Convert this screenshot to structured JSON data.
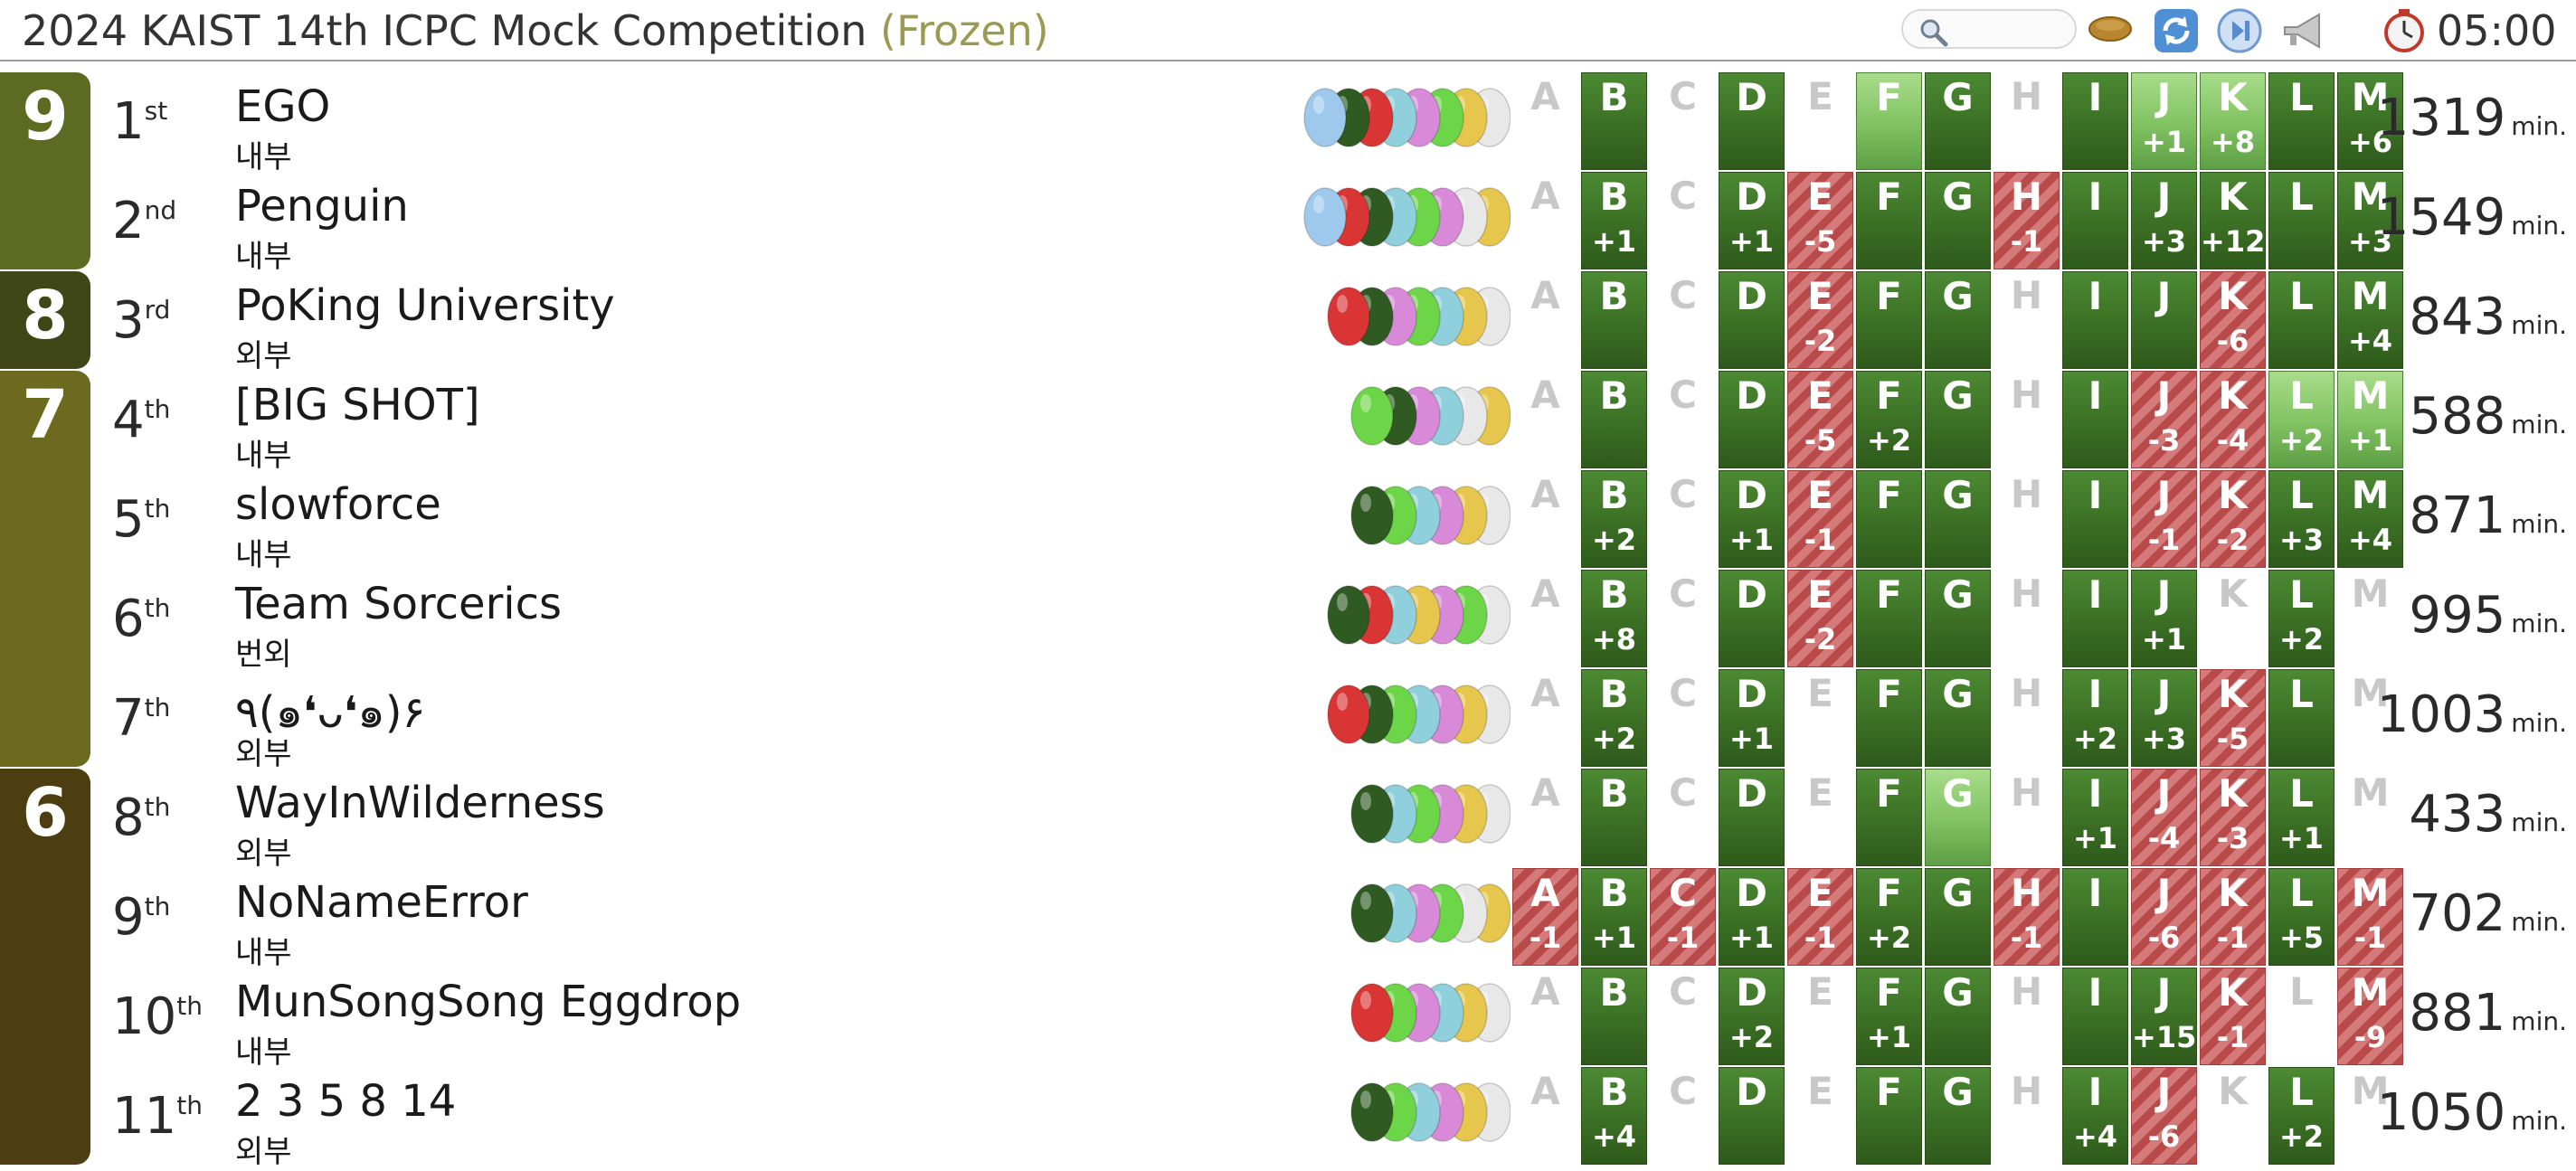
{
  "header": {
    "title": "2024 KAIST 14th ICPC Mock Competition",
    "frozen": "(Frozen)",
    "time": "05:00",
    "icons": [
      "search-icon",
      "football-icon",
      "refresh-icon",
      "skip-icon",
      "megaphone-icon",
      "clock-icon"
    ]
  },
  "problems": [
    "A",
    "B",
    "C",
    "D",
    "E",
    "F",
    "G",
    "H",
    "I",
    "J",
    "K",
    "L",
    "M"
  ],
  "penalty_unit": "min.",
  "groups": [
    {
      "solved": "9",
      "rows": [
        0,
        1
      ],
      "color": "#5c6a22"
    },
    {
      "solved": "8",
      "rows": [
        2,
        2
      ],
      "color": "#3f4716"
    },
    {
      "solved": "7",
      "rows": [
        3,
        6
      ],
      "color": "#6c6a1e"
    },
    {
      "solved": "6",
      "rows": [
        7,
        10
      ],
      "color": "#4d3e11"
    }
  ],
  "teams": [
    {
      "rank": "1",
      "suffix": "st",
      "name": "EGO",
      "affiliation": "내부",
      "balloons": [
        "#9ec9ec",
        "#2f5b22",
        "#d93535",
        "#8fd0dc",
        "#d88ad8",
        "#6dd648",
        "#e6c64c",
        "#e8e8e8"
      ],
      "penalty": "1319",
      "cells": [
        [
          "none",
          ""
        ],
        [
          "solved",
          ""
        ],
        [
          "none",
          ""
        ],
        [
          "solved",
          ""
        ],
        [
          "none",
          ""
        ],
        [
          "first",
          ""
        ],
        [
          "solved",
          ""
        ],
        [
          "none",
          ""
        ],
        [
          "solved",
          ""
        ],
        [
          "first",
          "+1"
        ],
        [
          "first",
          "+8"
        ],
        [
          "solved",
          ""
        ],
        [
          "solved",
          "+6"
        ]
      ]
    },
    {
      "rank": "2",
      "suffix": "nd",
      "name": "Penguin",
      "affiliation": "내부",
      "balloons": [
        "#9ec9ec",
        "#d93535",
        "#2f5b22",
        "#8fd0dc",
        "#6dd648",
        "#d88ad8",
        "#e8e8e8",
        "#e6c64c"
      ],
      "penalty": "1549",
      "cells": [
        [
          "none",
          ""
        ],
        [
          "solved",
          "+1"
        ],
        [
          "none",
          ""
        ],
        [
          "solved",
          "+1"
        ],
        [
          "wrong",
          "-5"
        ],
        [
          "solved",
          ""
        ],
        [
          "solved",
          ""
        ],
        [
          "wrong",
          "-1"
        ],
        [
          "solved",
          ""
        ],
        [
          "solved",
          "+3"
        ],
        [
          "solved",
          "+12"
        ],
        [
          "solved",
          ""
        ],
        [
          "solved",
          "+3"
        ]
      ]
    },
    {
      "rank": "3",
      "suffix": "rd",
      "name": "PoKing University",
      "affiliation": "외부",
      "balloons": [
        "#d93535",
        "#2f5b22",
        "#d88ad8",
        "#6dd648",
        "#8fd0dc",
        "#e6c64c",
        "#e8e8e8"
      ],
      "penalty": "843",
      "cells": [
        [
          "none",
          ""
        ],
        [
          "solved",
          ""
        ],
        [
          "none",
          ""
        ],
        [
          "solved",
          ""
        ],
        [
          "wrong",
          "-2"
        ],
        [
          "solved",
          ""
        ],
        [
          "solved",
          ""
        ],
        [
          "none",
          ""
        ],
        [
          "solved",
          ""
        ],
        [
          "solved",
          ""
        ],
        [
          "wrong",
          "-6"
        ],
        [
          "solved",
          ""
        ],
        [
          "solved",
          "+4"
        ]
      ]
    },
    {
      "rank": "4",
      "suffix": "th",
      "name": "[BIG SHOT]",
      "affiliation": "내부",
      "balloons": [
        "#6dd648",
        "#2f5b22",
        "#d88ad8",
        "#8fd0dc",
        "#e8e8e8",
        "#e6c64c"
      ],
      "penalty": "588",
      "cells": [
        [
          "none",
          ""
        ],
        [
          "solved",
          ""
        ],
        [
          "none",
          ""
        ],
        [
          "solved",
          ""
        ],
        [
          "wrong",
          "-5"
        ],
        [
          "solved",
          "+2"
        ],
        [
          "solved",
          ""
        ],
        [
          "none",
          ""
        ],
        [
          "solved",
          ""
        ],
        [
          "wrong",
          "-3"
        ],
        [
          "wrong",
          "-4"
        ],
        [
          "first",
          "+2"
        ],
        [
          "first",
          "+1"
        ]
      ]
    },
    {
      "rank": "5",
      "suffix": "th",
      "name": "slowforce",
      "affiliation": "내부",
      "balloons": [
        "#2f5b22",
        "#6dd648",
        "#8fd0dc",
        "#d88ad8",
        "#e6c64c",
        "#e8e8e8"
      ],
      "penalty": "871",
      "cells": [
        [
          "none",
          ""
        ],
        [
          "solved",
          "+2"
        ],
        [
          "none",
          ""
        ],
        [
          "solved",
          "+1"
        ],
        [
          "wrong",
          "-1"
        ],
        [
          "solved",
          ""
        ],
        [
          "solved",
          ""
        ],
        [
          "none",
          ""
        ],
        [
          "solved",
          ""
        ],
        [
          "wrong",
          "-1"
        ],
        [
          "wrong",
          "-2"
        ],
        [
          "solved",
          "+3"
        ],
        [
          "solved",
          "+4"
        ]
      ]
    },
    {
      "rank": "6",
      "suffix": "th",
      "name": "Team Sorcerics",
      "affiliation": "번외",
      "balloons": [
        "#2f5b22",
        "#d93535",
        "#8fd0dc",
        "#e6c64c",
        "#d88ad8",
        "#6dd648",
        "#e8e8e8"
      ],
      "penalty": "995",
      "cells": [
        [
          "none",
          ""
        ],
        [
          "solved",
          "+8"
        ],
        [
          "none",
          ""
        ],
        [
          "solved",
          ""
        ],
        [
          "wrong",
          "-2"
        ],
        [
          "solved",
          ""
        ],
        [
          "solved",
          ""
        ],
        [
          "none",
          ""
        ],
        [
          "solved",
          ""
        ],
        [
          "solved",
          "+1"
        ],
        [
          "none",
          ""
        ],
        [
          "solved",
          "+2"
        ],
        [
          "none",
          ""
        ]
      ]
    },
    {
      "rank": "7",
      "suffix": "th",
      "name": "٩(๑❛ᴗ❛๑)۶",
      "affiliation": "외부",
      "balloons": [
        "#d93535",
        "#2f5b22",
        "#6dd648",
        "#8fd0dc",
        "#d88ad8",
        "#e6c64c",
        "#e8e8e8"
      ],
      "penalty": "1003",
      "cells": [
        [
          "none",
          ""
        ],
        [
          "solved",
          "+2"
        ],
        [
          "none",
          ""
        ],
        [
          "solved",
          "+1"
        ],
        [
          "none",
          ""
        ],
        [
          "solved",
          ""
        ],
        [
          "solved",
          ""
        ],
        [
          "none",
          ""
        ],
        [
          "solved",
          "+2"
        ],
        [
          "solved",
          "+3"
        ],
        [
          "wrong",
          "-5"
        ],
        [
          "solved",
          ""
        ],
        [
          "none",
          ""
        ]
      ]
    },
    {
      "rank": "8",
      "suffix": "th",
      "name": "WayInWilderness",
      "affiliation": "외부",
      "balloons": [
        "#2f5b22",
        "#8fd0dc",
        "#6dd648",
        "#d88ad8",
        "#e6c64c",
        "#e8e8e8"
      ],
      "penalty": "433",
      "cells": [
        [
          "none",
          ""
        ],
        [
          "solved",
          ""
        ],
        [
          "none",
          ""
        ],
        [
          "solved",
          ""
        ],
        [
          "none",
          ""
        ],
        [
          "solved",
          ""
        ],
        [
          "first",
          ""
        ],
        [
          "none",
          ""
        ],
        [
          "solved",
          "+1"
        ],
        [
          "wrong",
          "-4"
        ],
        [
          "wrong",
          "-3"
        ],
        [
          "solved",
          "+1"
        ],
        [
          "none",
          ""
        ]
      ]
    },
    {
      "rank": "9",
      "suffix": "th",
      "name": "NoNameError",
      "affiliation": "내부",
      "balloons": [
        "#2f5b22",
        "#8fd0dc",
        "#d88ad8",
        "#6dd648",
        "#e8e8e8",
        "#e6c64c"
      ],
      "penalty": "702",
      "cells": [
        [
          "wrong",
          "-1"
        ],
        [
          "solved",
          "+1"
        ],
        [
          "wrong",
          "-1"
        ],
        [
          "solved",
          "+1"
        ],
        [
          "wrong",
          "-1"
        ],
        [
          "solved",
          "+2"
        ],
        [
          "solved",
          ""
        ],
        [
          "wrong",
          "-1"
        ],
        [
          "solved",
          ""
        ],
        [
          "wrong",
          "-6"
        ],
        [
          "wrong",
          "-1"
        ],
        [
          "solved",
          "+5"
        ],
        [
          "wrong",
          "-1"
        ]
      ]
    },
    {
      "rank": "10",
      "suffix": "th",
      "name": "MunSongSong Eggdrop",
      "affiliation": "내부",
      "balloons": [
        "#d93535",
        "#6dd648",
        "#d88ad8",
        "#8fd0dc",
        "#e6c64c",
        "#e8e8e8"
      ],
      "penalty": "881",
      "cells": [
        [
          "none",
          ""
        ],
        [
          "solved",
          ""
        ],
        [
          "none",
          ""
        ],
        [
          "solved",
          "+2"
        ],
        [
          "none",
          ""
        ],
        [
          "solved",
          "+1"
        ],
        [
          "solved",
          ""
        ],
        [
          "none",
          ""
        ],
        [
          "solved",
          ""
        ],
        [
          "solved",
          "+15"
        ],
        [
          "wrong",
          "-1"
        ],
        [
          "none",
          ""
        ],
        [
          "wrong",
          "-9"
        ]
      ]
    },
    {
      "rank": "11",
      "suffix": "th",
      "name": "2 3 5 8 14",
      "affiliation": "외부",
      "balloons": [
        "#2f5b22",
        "#6dd648",
        "#8fd0dc",
        "#d88ad8",
        "#e6c64c",
        "#e8e8e8"
      ],
      "penalty": "1050",
      "cells": [
        [
          "none",
          ""
        ],
        [
          "solved",
          "+4"
        ],
        [
          "none",
          ""
        ],
        [
          "solved",
          ""
        ],
        [
          "none",
          ""
        ],
        [
          "solved",
          ""
        ],
        [
          "solved",
          ""
        ],
        [
          "none",
          ""
        ],
        [
          "solved",
          "+4"
        ],
        [
          "wrong",
          "-6"
        ],
        [
          "none",
          ""
        ],
        [
          "solved",
          "+2"
        ],
        [
          "none",
          ""
        ]
      ]
    }
  ]
}
